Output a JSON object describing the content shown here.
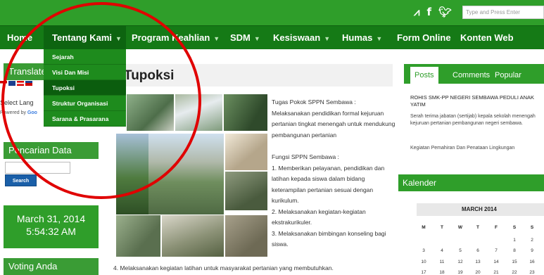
{
  "topbar": {
    "icons": [
      "rss-icon",
      "facebook-icon",
      "twitter-icon"
    ],
    "search_placeholder": "Type and Press Enter"
  },
  "nav": {
    "items": [
      {
        "label": "Home",
        "has_caret": false
      },
      {
        "label": "Tentang Kami",
        "has_caret": true,
        "active": true
      },
      {
        "label": "Program Keahlian",
        "has_caret": true
      },
      {
        "label": "SDM",
        "has_caret": true
      },
      {
        "label": "Kesiswaan",
        "has_caret": true
      },
      {
        "label": "Humas",
        "has_caret": true
      },
      {
        "label": "Form Online",
        "has_caret": false
      },
      {
        "label": "Konten Web",
        "has_caret": false
      }
    ],
    "dropdown": [
      {
        "label": "Sejarah"
      },
      {
        "label": "Visi Dan Misi"
      },
      {
        "label": "Tupoksi",
        "active": true
      },
      {
        "label": "Struktur Organisasi"
      },
      {
        "label": "Sarana & Prasarana"
      }
    ]
  },
  "sidebar": {
    "translate_title": "Translate",
    "select_language": "Select Lang",
    "powered_by": "Powered by",
    "powered_brand": "Goo",
    "search_title": "Pencarian Data",
    "search_button": "Search",
    "date": "March 31, 2014",
    "time": "5:54:32 AM",
    "voting_title": "Voting Anda"
  },
  "main": {
    "title": "Tupoksi",
    "tugas_heading": "Tugas Pokok SPPN Sembawa :",
    "tugas_text": "Melaksanakan pendidikan formal kejuruan pertanian tingkat menengah untuk mendukung pembangunan pertanian",
    "fungsi_heading": "Fungsi SPPN Sembawa :",
    "fungsi_items": [
      "1. Memberikan pelayanan, pendidikan dan latihan kepada siswa dalam bidang keterampilan pertanian sesuai dengan kurikulum.",
      "2. Melaksanakan kegiatan-kegiatan ekstrakurikuler.",
      "3. Melaksanakan bimbingan konseling bagi siswa."
    ],
    "bottom_line": "4. Melaksanakan kegiatan latihan untuk masyarakat pertanian yang membutuhkan."
  },
  "rightbar": {
    "tabs": [
      "Posts",
      "Comments",
      "Popular"
    ],
    "posts": [
      {
        "title": "ROHIS SMK-PP NEGERI SEMBAWA PEDULI ANAK YATIM"
      },
      {
        "title": "Serah terima jabatan (sertijab) kepala sekolah menengah kejuruan pertanian pembangunan negeri sembawa."
      },
      {
        "title": "Kegiatan Pemahiran Dan Penataan Lingkungan"
      }
    ],
    "calendar_title": "Kalender",
    "calendar_month": "MARCH 2014",
    "weekdays": [
      "M",
      "T",
      "W",
      "T",
      "F",
      "S",
      "S"
    ],
    "week1": [
      "",
      "",
      "",
      "",
      "",
      "1",
      "2"
    ],
    "week2": [
      "3",
      "4",
      "5",
      "6",
      "7",
      "8",
      "9"
    ],
    "week3": [
      "10",
      "11",
      "12",
      "13",
      "14",
      "15",
      "16"
    ],
    "week4": [
      "17",
      "18",
      "19",
      "20",
      "21",
      "22",
      "23"
    ]
  },
  "colors": {
    "brand_green": "#2f9e2a",
    "nav_green": "#157a16",
    "annotation_red": "#e00000"
  }
}
